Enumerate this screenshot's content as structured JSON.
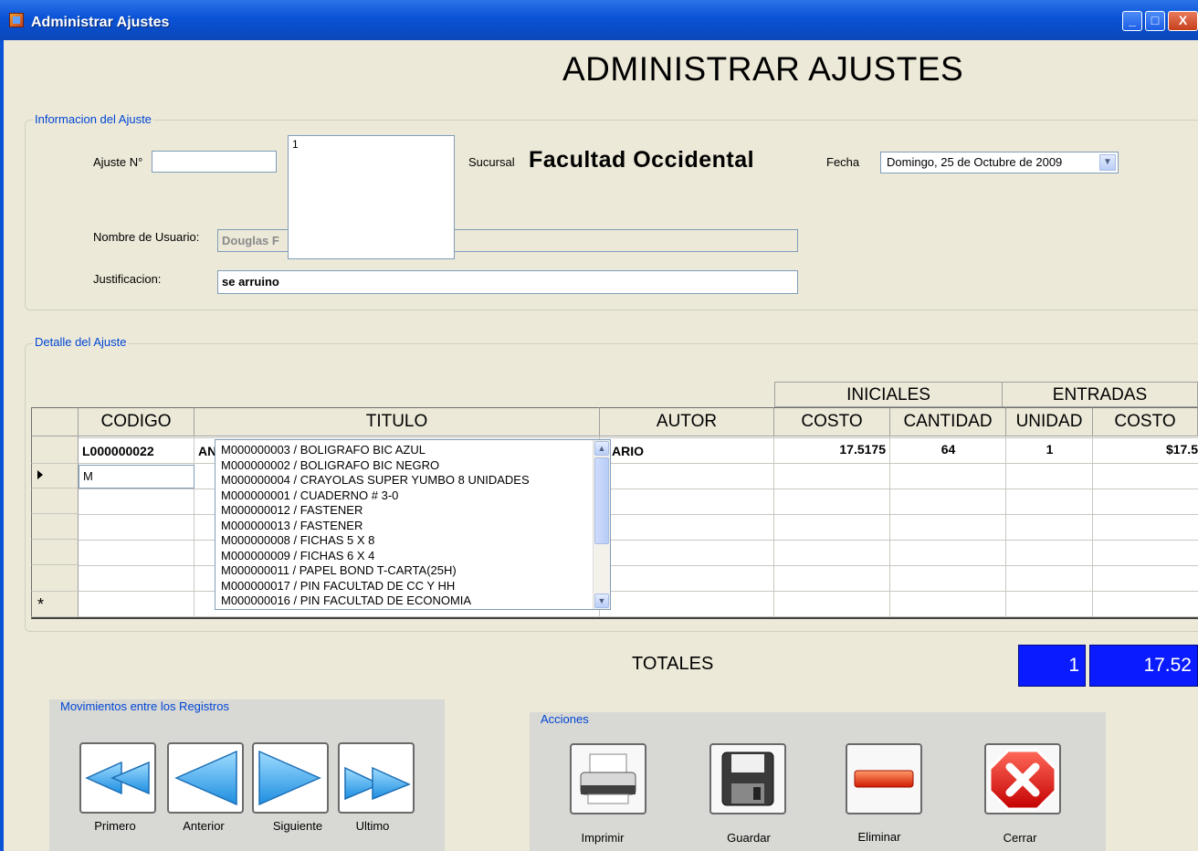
{
  "window": {
    "title": "Administrar Ajustes",
    "minimize": "_",
    "maximize": "□",
    "close": "X"
  },
  "page_title": "ADMINISTRAR AJUSTES",
  "info_group": {
    "legend": "Informacion del Ajuste",
    "ajuste_label": "Ajuste N°",
    "ajuste_value": "",
    "ajuste_list": [
      "1"
    ],
    "sucursal_label": "Sucursal",
    "sucursal_value": "Facultad Occidental",
    "fecha_label": "Fecha",
    "fecha_day": "Domingo",
    "fecha_num": "25",
    "fecha_month": "Octubre",
    "fecha_year": "2009",
    "usuario_label": "Nombre de Usuario:",
    "usuario_value": "Douglas F",
    "justificacion_label": "Justificacion:",
    "justificacion_value": "se arruino"
  },
  "detail_group": {
    "legend": "Detalle del Ajuste",
    "super_headers": [
      "INICIALES",
      "ENTRADAS"
    ],
    "columns": [
      "CODIGO",
      "TITULO",
      "AUTOR",
      "COSTO",
      "CANTIDAD",
      "UNIDAD",
      "COSTO"
    ],
    "row1": {
      "codigo": "L000000022",
      "titulo": "AN",
      "autor": "ARIO",
      "costo": "17.5175",
      "cantidad": "64",
      "unidad": "1",
      "costo2": "$17.5"
    },
    "row2": {
      "codigo": "M"
    },
    "new_row_marker": "*",
    "dropdown_items": [
      "M000000003 / BOLIGRAFO BIC AZUL",
      "M000000002 / BOLIGRAFO BIC NEGRO",
      "M000000004 / CRAYOLAS SUPER YUMBO 8 UNIDADES",
      "M000000001 / CUADERNO # 3-0",
      "M000000012 / FASTENER",
      "M000000013 / FASTENER",
      "M000000008 / FICHAS 5 X 8",
      "M000000009 / FICHAS 6 X 4",
      "M000000011 / PAPEL BOND T-CARTA(25H)",
      "M000000017 / PIN FACULTAD DE CC Y HH",
      "M000000016 / PIN FACULTAD DE ECONOMIA"
    ]
  },
  "totals": {
    "label": "TOTALES",
    "unidades": "1",
    "costo": "17.52"
  },
  "nav_group": {
    "legend": "Movimientos entre los Registros",
    "buttons": [
      "Primero",
      "Anterior",
      "Siguiente",
      "Ultimo"
    ]
  },
  "actions_group": {
    "legend": "Acciones",
    "buttons": [
      "Imprimir",
      "Guardar",
      "Eliminar",
      "Cerrar"
    ]
  }
}
